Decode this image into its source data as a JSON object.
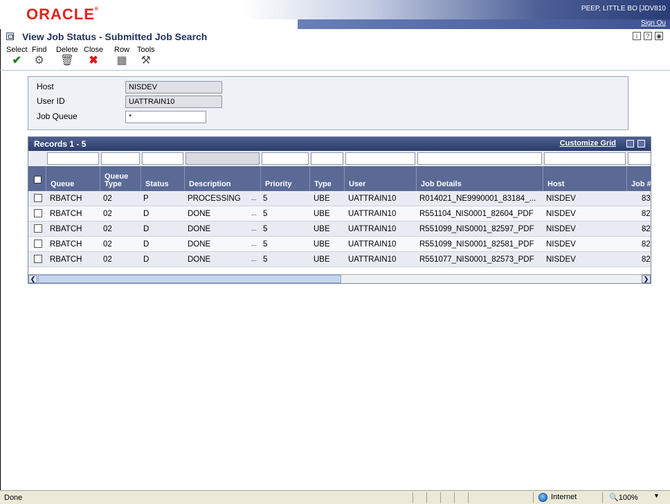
{
  "header": {
    "logo": "ORACLE",
    "user": "PEEP, LITTLE BO  [JDV810",
    "sign_out": "Sign Ou"
  },
  "page": {
    "title": "View Job Status - Submitted Job Search"
  },
  "toolbar": {
    "select_label": "Select",
    "find_label": "Find",
    "delete_label": "Delete",
    "close_label": "Close",
    "row_label": "Row",
    "tools_label": "Tools"
  },
  "criteria": {
    "host_label": "Host",
    "host_value": "NISDEV",
    "userid_label": "User ID",
    "userid_value": "UATTRAIN10",
    "jobqueue_label": "Job Queue",
    "jobqueue_value": "*"
  },
  "grid": {
    "records_label": "Records 1 - 5",
    "customize_label": "Customize Grid",
    "columns": {
      "queue": "Queue",
      "queue_type_1": "Queue",
      "queue_type_2": "Type",
      "status": "Status",
      "description": "Description",
      "priority": "Priority",
      "type": "Type",
      "user": "User",
      "job_details": "Job Details",
      "host": "Host",
      "job_num": "Job #"
    },
    "rows": [
      {
        "queue": "RBATCH",
        "queue_type": "02",
        "status": "P",
        "description": "PROCESSING",
        "ellipsis": "...",
        "priority": "5",
        "type": "UBE",
        "user": "UATTRAIN10",
        "job_details": "R014021_NE9990001_83184_...",
        "host": "NISDEV",
        "job_num": "83"
      },
      {
        "queue": "RBATCH",
        "queue_type": "02",
        "status": "D",
        "description": "DONE",
        "ellipsis": "...",
        "priority": "5",
        "type": "UBE",
        "user": "UATTRAIN10",
        "job_details": "R551104_NIS0001_82604_PDF",
        "host": "NISDEV",
        "job_num": "82"
      },
      {
        "queue": "RBATCH",
        "queue_type": "02",
        "status": "D",
        "description": "DONE",
        "ellipsis": "...",
        "priority": "5",
        "type": "UBE",
        "user": "UATTRAIN10",
        "job_details": "R551099_NIS0001_82597_PDF",
        "host": "NISDEV",
        "job_num": "82"
      },
      {
        "queue": "RBATCH",
        "queue_type": "02",
        "status": "D",
        "description": "DONE",
        "ellipsis": "...",
        "priority": "5",
        "type": "UBE",
        "user": "UATTRAIN10",
        "job_details": "R551099_NIS0001_82581_PDF",
        "host": "NISDEV",
        "job_num": "82"
      },
      {
        "queue": "RBATCH",
        "queue_type": "02",
        "status": "D",
        "description": "DONE",
        "ellipsis": "...",
        "priority": "5",
        "type": "UBE",
        "user": "UATTRAIN10",
        "job_details": "R551077_NIS0001_82573_PDF",
        "host": "NISDEV",
        "job_num": "82"
      }
    ]
  },
  "statusbar": {
    "status": "Done",
    "zone": "Internet",
    "zoom": "100%"
  }
}
